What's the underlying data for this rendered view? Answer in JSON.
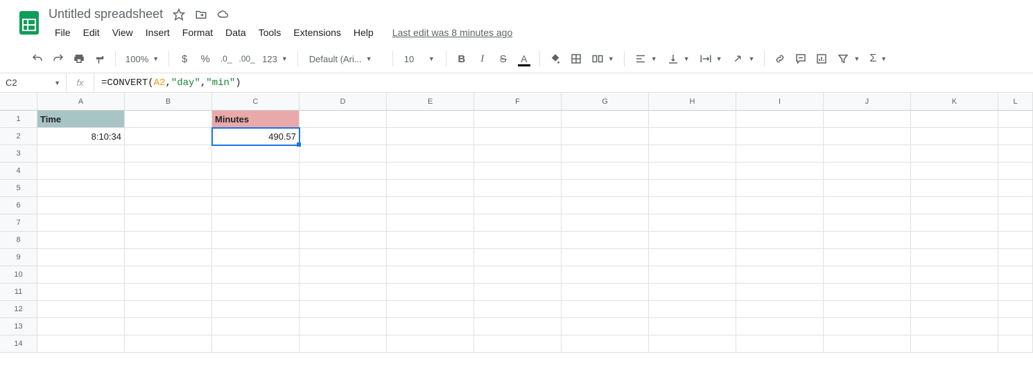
{
  "header": {
    "doc_title": "Untitled spreadsheet",
    "last_edit": "Last edit was 8 minutes ago"
  },
  "menubar": [
    "File",
    "Edit",
    "View",
    "Insert",
    "Format",
    "Data",
    "Tools",
    "Extensions",
    "Help"
  ],
  "toolbar": {
    "zoom": "100%",
    "font": "Default (Ari...",
    "font_size": "10"
  },
  "namebox": "C2",
  "formula": {
    "raw": "=CONVERT(A2, \"day\", \"min\")",
    "parts": {
      "eq": "=",
      "fn": "CONVERT",
      "open": "(",
      "ref": "A2",
      "c1": ", ",
      "s1": "\"day\"",
      "c2": ", ",
      "s2": "\"min\"",
      "close": ")"
    }
  },
  "columns": [
    "A",
    "B",
    "C",
    "D",
    "E",
    "F",
    "G",
    "H",
    "I",
    "J",
    "K",
    "L"
  ],
  "rows": [
    "1",
    "2",
    "3",
    "4",
    "5",
    "6",
    "7",
    "8",
    "9",
    "10",
    "11",
    "12",
    "13",
    "14"
  ],
  "cells": {
    "A1": "Time",
    "C1": "Minutes",
    "A2": "8:10:34",
    "C2": "490.57"
  },
  "selected_cell": "C2"
}
